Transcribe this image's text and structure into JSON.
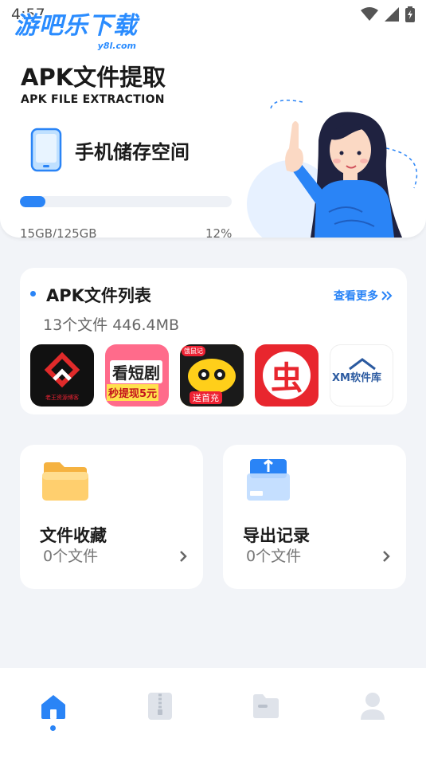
{
  "status": {
    "time": "4:57"
  },
  "watermark": {
    "main": "游吧乐下载",
    "sub": "y8l.com"
  },
  "header": {
    "title": "APK文件提取",
    "subtitle": "APK FILE EXTRACTION",
    "storage_title": "手机储存空间",
    "used_text": "15GB/125GB",
    "percent_text": "12%",
    "progress_fraction": 0.12
  },
  "apk_list": {
    "title": "APK文件列表",
    "see_more": "查看更多",
    "summary": "13个文件  446.4MB",
    "apps": [
      {
        "name": "app-icon-1",
        "label": "老王资源博客"
      },
      {
        "name": "app-icon-2",
        "label_top": "看短剧",
        "label_bottom": "秒提现5元"
      },
      {
        "name": "app-icon-3",
        "label_top": "饿鼠记",
        "label_bottom": "送首充"
      },
      {
        "name": "app-icon-4",
        "label": "虫"
      },
      {
        "name": "app-icon-5",
        "label": "XM软件库"
      }
    ]
  },
  "tiles": {
    "favorites": {
      "title": "文件收藏",
      "count": "0个文件"
    },
    "export": {
      "title": "导出记录",
      "count": "0个文件"
    }
  },
  "nav": {
    "items": [
      "home",
      "archive",
      "folder",
      "profile"
    ],
    "active": "home"
  },
  "colors": {
    "accent": "#2a84f6",
    "background": "#f2f4f8"
  }
}
